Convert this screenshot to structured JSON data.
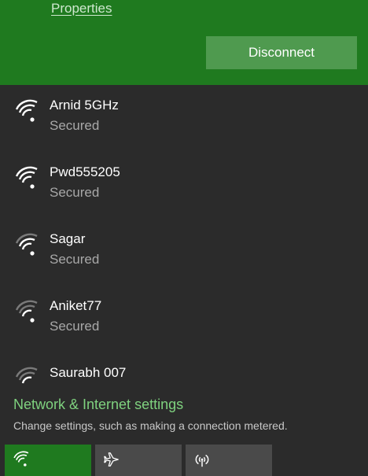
{
  "connected": {
    "properties_label": "Properties",
    "disconnect_label": "Disconnect"
  },
  "networks": [
    {
      "name": "Arnid 5GHz",
      "status": "Secured",
      "icon": "wifi-signal-icon"
    },
    {
      "name": "Pwd555205",
      "status": "Secured",
      "icon": "wifi-signal-icon"
    },
    {
      "name": "Sagar",
      "status": "Secured",
      "icon": "wifi-signal-icon"
    },
    {
      "name": "Aniket77",
      "status": "Secured",
      "icon": "wifi-signal-icon"
    },
    {
      "name": "Saurabh 007",
      "status": "",
      "icon": "wifi-signal-icon"
    }
  ],
  "settings": {
    "link_label": "Network & Internet settings",
    "description": "Change settings, such as making a connection metered."
  },
  "quick_actions": [
    {
      "name": "wifi",
      "icon": "wifi-icon"
    },
    {
      "name": "airplane-mode",
      "icon": "airplane-icon"
    },
    {
      "name": "mobile-hotspot",
      "icon": "hotspot-icon"
    }
  ],
  "colors": {
    "accent_green": "#1f7a1f",
    "button_green": "#4f9a4f",
    "link_green": "#7fd27f",
    "background": "#2b2b2b"
  }
}
